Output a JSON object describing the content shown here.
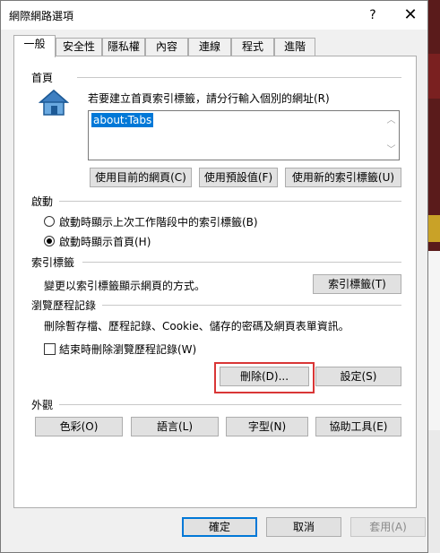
{
  "window": {
    "title": "網際網路選項",
    "help_icon": "?",
    "close_icon": "✕"
  },
  "tabs": [
    "一般",
    "安全性",
    "隱私權",
    "內容",
    "連線",
    "程式",
    "進階"
  ],
  "home": {
    "heading": "首頁",
    "description": "若要建立首頁索引標籤，請分行輸入個別的網址(R)",
    "url_value": "about:Tabs",
    "buttons": [
      "使用目前的網頁(C)",
      "使用預設值(F)",
      "使用新的索引標籤(U)"
    ]
  },
  "startup": {
    "heading": "啟動",
    "options": [
      "啟動時顯示上次工作階段中的索引標籤(B)",
      "啟動時顯示首頁(H)"
    ],
    "selected_index": 1
  },
  "tabs_section": {
    "heading": "索引標籤",
    "description": "變更以索引標籤顯示網頁的方式。",
    "button": "索引標籤(T)"
  },
  "history": {
    "heading": "瀏覽歷程記錄",
    "description": "刪除暫存檔、歷程記錄、Cookie、儲存的密碼及網頁表單資訊。",
    "checkbox_label": "結束時刪除瀏覽歷程記錄(W)",
    "checkbox_checked": false,
    "delete_button": "刪除(D)...",
    "settings_button": "設定(S)"
  },
  "appearance": {
    "heading": "外觀",
    "buttons": [
      "色彩(O)",
      "語言(L)",
      "字型(N)",
      "協助工具(E)"
    ]
  },
  "footer": {
    "ok": "確定",
    "cancel": "取消",
    "apply": "套用(A)"
  },
  "colors": {
    "highlight": "#d93636",
    "selection": "#0078d7",
    "focus_border": "#0078d7"
  }
}
